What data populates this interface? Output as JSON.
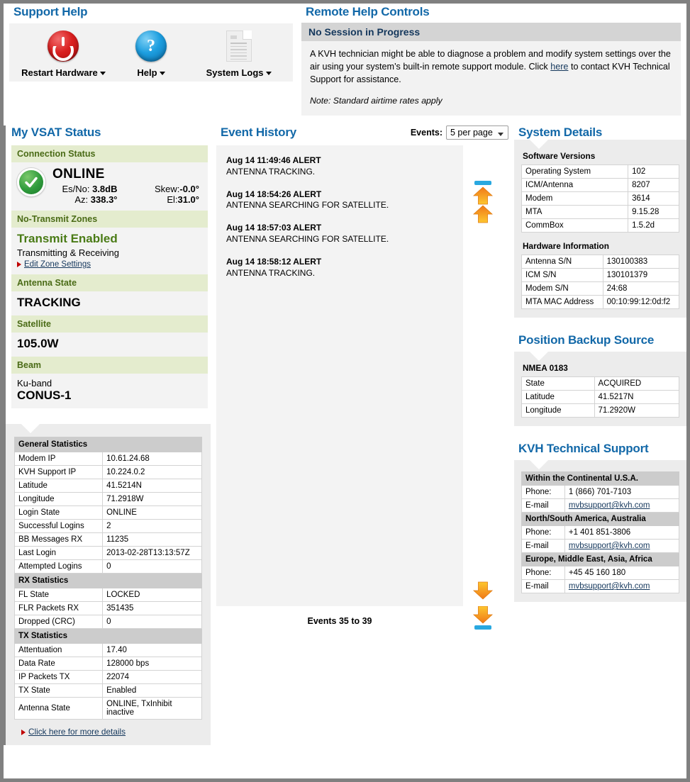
{
  "support_help": {
    "title": "Support Help",
    "items": [
      {
        "label": "Restart Hardware",
        "icon": "power-icon",
        "has_caret": true
      },
      {
        "label": "Help",
        "icon": "question-mark-icon",
        "has_caret": true
      },
      {
        "label": "System Logs",
        "icon": "document-icon",
        "has_caret": true
      }
    ],
    "help_glyph": "?"
  },
  "remote_help": {
    "title": "Remote Help Controls",
    "status_header": "No Session in Progress",
    "body_part1": "A KVH technician might be able to diagnose a problem and modify system settings over the air using your system’s built-in remote support module. Click ",
    "body_link": "here",
    "body_part2": " to contact KVH Technical Support for assistance.",
    "note": "Note: Standard airtime rates apply"
  },
  "vsat": {
    "title": "My VSAT Status",
    "connection_status_header": "Connection Status",
    "state": "ONLINE",
    "esno_label": "Es/No:",
    "esno_value": "3.8dB",
    "skew_label": "Skew:",
    "skew_value": "-0.0°",
    "az_label": "Az:",
    "az_value": "338.3°",
    "el_label": "El:",
    "el_value": "31.0°",
    "no_transmit_header": "No-Transmit Zones",
    "transmit_state": "Transmit Enabled",
    "transmit_sub": "Transmitting & Receiving",
    "edit_zone_link": "Edit Zone Settings",
    "antenna_state_header": "Antenna State",
    "antenna_state": "TRACKING",
    "satellite_header": "Satellite",
    "satellite": "105.0W",
    "beam_header": "Beam",
    "beam_band": "Ku-band",
    "beam_name": "CONUS-1"
  },
  "stats": {
    "general_header": "General Statistics",
    "general_rows": [
      [
        "Modem IP",
        "10.61.24.68"
      ],
      [
        "KVH Support IP",
        "10.224.0.2"
      ],
      [
        "Latitude",
        "41.5214N"
      ],
      [
        "Longitude",
        "71.2918W"
      ],
      [
        "Login State",
        "ONLINE"
      ],
      [
        "Successful Logins",
        "2"
      ],
      [
        "BB Messages RX",
        "11235"
      ],
      [
        "Last Login",
        "2013-02-28T13:13:57Z"
      ],
      [
        "Attempted Logins",
        "0"
      ]
    ],
    "rx_header": "RX Statistics",
    "rx_rows": [
      [
        "FL State",
        "LOCKED"
      ],
      [
        "FLR Packets RX",
        "351435"
      ],
      [
        "Dropped (CRC)",
        "0"
      ]
    ],
    "tx_header": "TX Statistics",
    "tx_rows": [
      [
        "Attentuation",
        "17.40"
      ],
      [
        "Data Rate",
        "128000 bps"
      ],
      [
        "IP Packets TX",
        "22074"
      ],
      [
        "TX State",
        "Enabled"
      ],
      [
        "Antenna State",
        "ONLINE, TxInhibit inactive"
      ]
    ],
    "more_details_link": "Click here for more details"
  },
  "events": {
    "title": "Event History",
    "control_label": "Events:",
    "per_page_value": "5 per page",
    "items": [
      {
        "time": "Aug 14 11:49:46 ALERT",
        "message": "ANTENNA TRACKING."
      },
      {
        "time": "Aug 14 18:54:26 ALERT",
        "message": "ANTENNA SEARCHING FOR SATELLITE."
      },
      {
        "time": "Aug 14 18:57:03 ALERT",
        "message": "ANTENNA SEARCHING FOR SATELLITE."
      },
      {
        "time": "Aug 14 18:58:12 ALERT",
        "message": "ANTENNA TRACKING."
      }
    ],
    "footer": "Events 35 to 39",
    "nav": {
      "first": "first-page-arrow-icon",
      "prev": "previous-page-arrow-icon",
      "next": "next-page-arrow-icon",
      "last": "last-page-arrow-icon"
    }
  },
  "system_details": {
    "title": "System Details",
    "software_header": "Software Versions",
    "software_rows": [
      [
        "Operating System",
        "102"
      ],
      [
        "ICM/Antenna",
        "8207"
      ],
      [
        "Modem",
        "3614"
      ],
      [
        "MTA",
        "9.15.28"
      ],
      [
        "CommBox",
        "1.5.2d"
      ]
    ],
    "hardware_header": "Hardware Information",
    "hardware_rows": [
      [
        "Antenna S/N",
        "130100383"
      ],
      [
        "ICM S/N",
        "130101379"
      ],
      [
        "Modem S/N",
        "24:68"
      ],
      [
        "MTA MAC Address",
        "00:10:99:12:0d:f2"
      ]
    ]
  },
  "position_backup": {
    "title": "Position Backup Source",
    "source_header": "NMEA 0183",
    "rows": [
      [
        "State",
        "ACQUIRED"
      ],
      [
        "Latitude",
        "41.5217N"
      ],
      [
        "Longitude",
        "71.2920W"
      ]
    ]
  },
  "tech_support": {
    "title": "KVH Technical Support",
    "groups": [
      {
        "region": "Within the Continental U.S.A.",
        "phone_label": "Phone:",
        "phone": "1 (866) 701-7103",
        "email_label": "E-mail",
        "email": "mvbsupport@kvh.com"
      },
      {
        "region": "North/South America, Australia",
        "phone_label": "Phone:",
        "phone": "+1 401 851-3806",
        "email_label": "E-mail",
        "email": "mvbsupport@kvh.com"
      },
      {
        "region": "Europe, Middle East, Asia, Africa",
        "phone_label": "Phone:",
        "phone": "+45 45 160 180",
        "email_label": "E-mail",
        "email": "mvbsupport@kvh.com"
      }
    ]
  },
  "colors": {
    "heading_blue": "#1268a8",
    "green_header_bg": "#e4ecce",
    "green_header_text": "#4a6b16",
    "panel_gray": "#f2f2f2",
    "table_header_gray": "#cccccc",
    "transmit_green": "#4a7b16",
    "link_navy": "#14375c"
  }
}
